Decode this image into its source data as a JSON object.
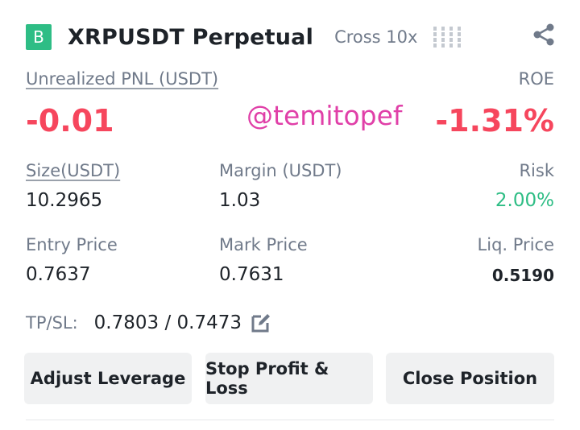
{
  "header": {
    "side_badge": "B",
    "symbol": "XRPUSDT Perpetual",
    "margin_mode": "Cross 10x",
    "risk_indicator_icon": "risk-bars-icon",
    "share_icon": "share-icon"
  },
  "pnl": {
    "label": "Unrealized PNL (USDT)",
    "value": "-0.01",
    "roe_label": "ROE",
    "roe_value": "-1.31%"
  },
  "watermark": "@temitopef",
  "stats": {
    "size_label": "Size(USDT)",
    "size_value": "10.2965",
    "margin_label": "Margin (USDT)",
    "margin_value": "1.03",
    "risk_label": "Risk",
    "risk_value": "2.00%",
    "entry_label": "Entry Price",
    "entry_value": "0.7637",
    "mark_label": "Mark Price",
    "mark_value": "0.7631",
    "liq_label": "Liq. Price",
    "liq_value": "0.5190"
  },
  "tpsl": {
    "label": "TP/SL:",
    "value": "0.7803 / 0.7473",
    "edit_icon": "edit-icon"
  },
  "buttons": {
    "adjust_leverage": "Adjust Leverage",
    "stop_profit_loss": "Stop Profit & Loss",
    "close_position": "Close Position"
  },
  "colors": {
    "negative": "#f6465d",
    "positive": "#2ebd85",
    "badge": "#2ebd85",
    "watermark": "#e040a8"
  }
}
